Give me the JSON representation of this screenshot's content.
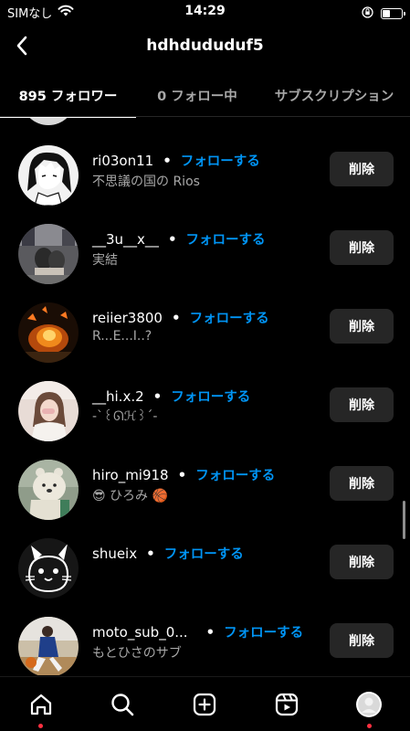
{
  "status": {
    "carrier": "SIMなし",
    "time": "14:29"
  },
  "header": {
    "title": "hdhdududuf5"
  },
  "tabs": [
    {
      "label": "895 フォロワー",
      "active": true
    },
    {
      "label": "0 フォロー中",
      "active": false
    },
    {
      "label": "サブスクリプション",
      "active": false
    }
  ],
  "followers": [
    {
      "username": "ri03on11",
      "subtitle": "不思議の国の Rios",
      "follow_label": "フォローする",
      "delete_label": "削除",
      "avatar": "manga-boy"
    },
    {
      "username": "__3u__x__",
      "subtitle": "実結",
      "follow_label": "フォローする",
      "delete_label": "削除",
      "avatar": "street"
    },
    {
      "username": "reiier3800",
      "subtitle": "R...E...I..?",
      "follow_label": "フォローする",
      "delete_label": "削除",
      "avatar": "fire"
    },
    {
      "username": "__hi.x.2",
      "subtitle": "-`꒰ᘏℋ꒱´-",
      "follow_label": "フォローする",
      "delete_label": "削除",
      "avatar": "girl"
    },
    {
      "username": "hiro_mi918",
      "subtitle": "😎 ひろみ 🏀",
      "follow_label": "フォローする",
      "delete_label": "削除",
      "avatar": "bear"
    },
    {
      "username": "shueix",
      "subtitle": "",
      "follow_label": "フォローする",
      "delete_label": "削除",
      "avatar": "cat"
    },
    {
      "username": "moto_sub_0...",
      "subtitle": "もとひさのサブ",
      "follow_label": "フォローする",
      "delete_label": "削除",
      "avatar": "sports"
    }
  ],
  "colors": {
    "background": "#000000",
    "accent": "#0095f6",
    "button": "#262626",
    "secondary_text": "#a8a8a8",
    "notification_dot": "#ff3040"
  },
  "bottom_nav": [
    {
      "icon": "home-icon",
      "notification_dot": true
    },
    {
      "icon": "search-icon",
      "notification_dot": false
    },
    {
      "icon": "create-icon",
      "notification_dot": false
    },
    {
      "icon": "reels-icon",
      "notification_dot": false
    },
    {
      "icon": "profile-avatar-icon",
      "notification_dot": true
    }
  ]
}
